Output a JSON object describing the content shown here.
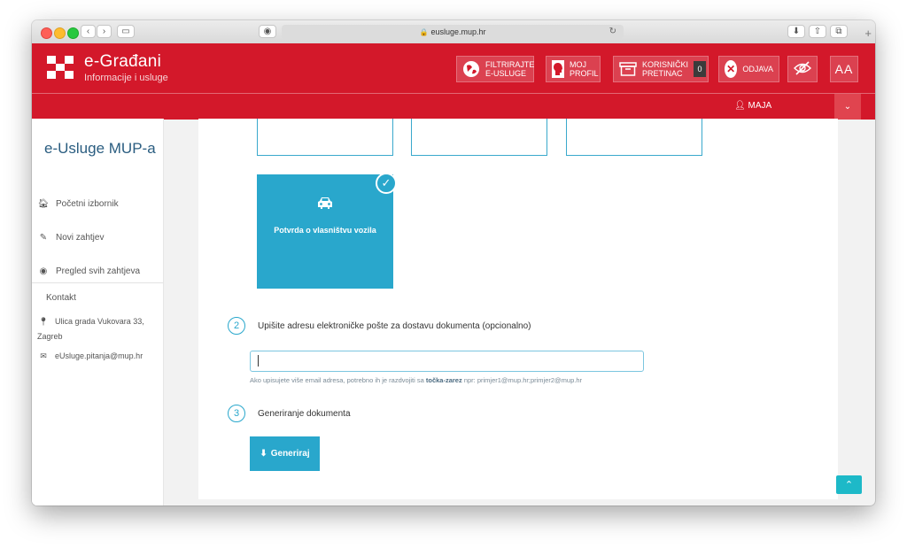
{
  "browser": {
    "url": "eusluge.mup.hr"
  },
  "header": {
    "brand_title": "e-Građani",
    "brand_subtitle": "Informacije i usluge",
    "filter_label_1": "FILTRIRAJTE",
    "filter_label_2": "E-USLUGE",
    "profile_label_1": "MOJ",
    "profile_label_2": "PROFIL",
    "inbox_label_1": "KORISNIČKI",
    "inbox_label_2": "PRETINAC",
    "inbox_count": "0",
    "logout_label": "ODJAVA",
    "font_size_label": "AA"
  },
  "subheader": {
    "user_name": "MAJA"
  },
  "sidebar": {
    "title": "e-Usluge MUP-a",
    "items": [
      {
        "label": "Početni izbornik"
      },
      {
        "label": "Novi zahtjev"
      },
      {
        "label": "Pregled svih zahtjeva"
      }
    ],
    "contact_heading": "Kontakt",
    "contact_address": "Ulica grada Vukovara 33, Zagreb",
    "contact_email": "eUsluge.pitanja@mup.hr"
  },
  "main": {
    "selected_card_label": "Potvrda o vlasništvu vozila",
    "step2_number": "2",
    "step2_label": "Upišite adresu elektroničke pošte za dostavu dokumenta (opcionalno)",
    "email_value": "",
    "hint_prefix": "Ako upisujete više email adresa, potrebno ih je razdvojiti sa",
    "hint_bold": "točka-zarez",
    "hint_suffix": "npr: primjer1@mup.hr;primjer2@mup.hr",
    "step3_number": "3",
    "step3_label": "Generiranje dokumenta",
    "generate_button": "Generiraj"
  },
  "colors": {
    "header_red": "#d3182a",
    "accent_blue": "#29a7cc",
    "scroll_top_teal": "#1db9c8"
  }
}
